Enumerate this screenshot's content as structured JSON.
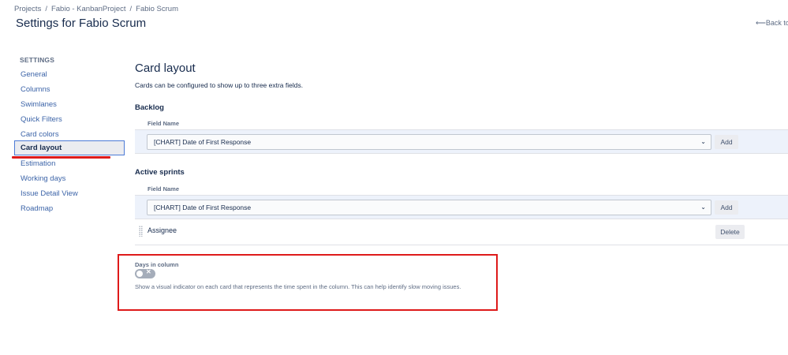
{
  "breadcrumbs": [
    "Projects",
    "Fabio - KanbanProject",
    "Fabio Scrum"
  ],
  "breadcrumb_separator": "/",
  "page_title": "Settings for Fabio Scrum",
  "back_link": "Back to",
  "sidebar": {
    "heading": "SETTINGS",
    "items": [
      {
        "label": "General"
      },
      {
        "label": "Columns"
      },
      {
        "label": "Swimlanes"
      },
      {
        "label": "Quick Filters"
      },
      {
        "label": "Card colors"
      },
      {
        "label": "Card layout",
        "active": true
      },
      {
        "label": "Estimation"
      },
      {
        "label": "Working days"
      },
      {
        "label": "Issue Detail View"
      },
      {
        "label": "Roadmap"
      }
    ]
  },
  "card_layout": {
    "title": "Card layout",
    "description": "Cards can be configured to show up to three extra fields.",
    "backlog": {
      "title": "Backlog",
      "field_name_label": "Field Name",
      "select_value": "[CHART] Date of First Response",
      "add_label": "Add"
    },
    "active_sprints": {
      "title": "Active sprints",
      "field_name_label": "Field Name",
      "select_value": "[CHART] Date of First Response",
      "add_label": "Add",
      "fields": [
        {
          "name": "Assignee",
          "delete_label": "Delete"
        }
      ]
    },
    "days_in_column": {
      "label": "Days in column",
      "enabled": false,
      "description": "Show a visual indicator on each card that represents the time spent in the column. This can help identify slow moving issues."
    }
  },
  "colors": {
    "highlight_red": "#de1a1a",
    "link_blue": "#3c64a8",
    "active_border": "#4c7bd6",
    "row_bg": "#edf2fb"
  }
}
